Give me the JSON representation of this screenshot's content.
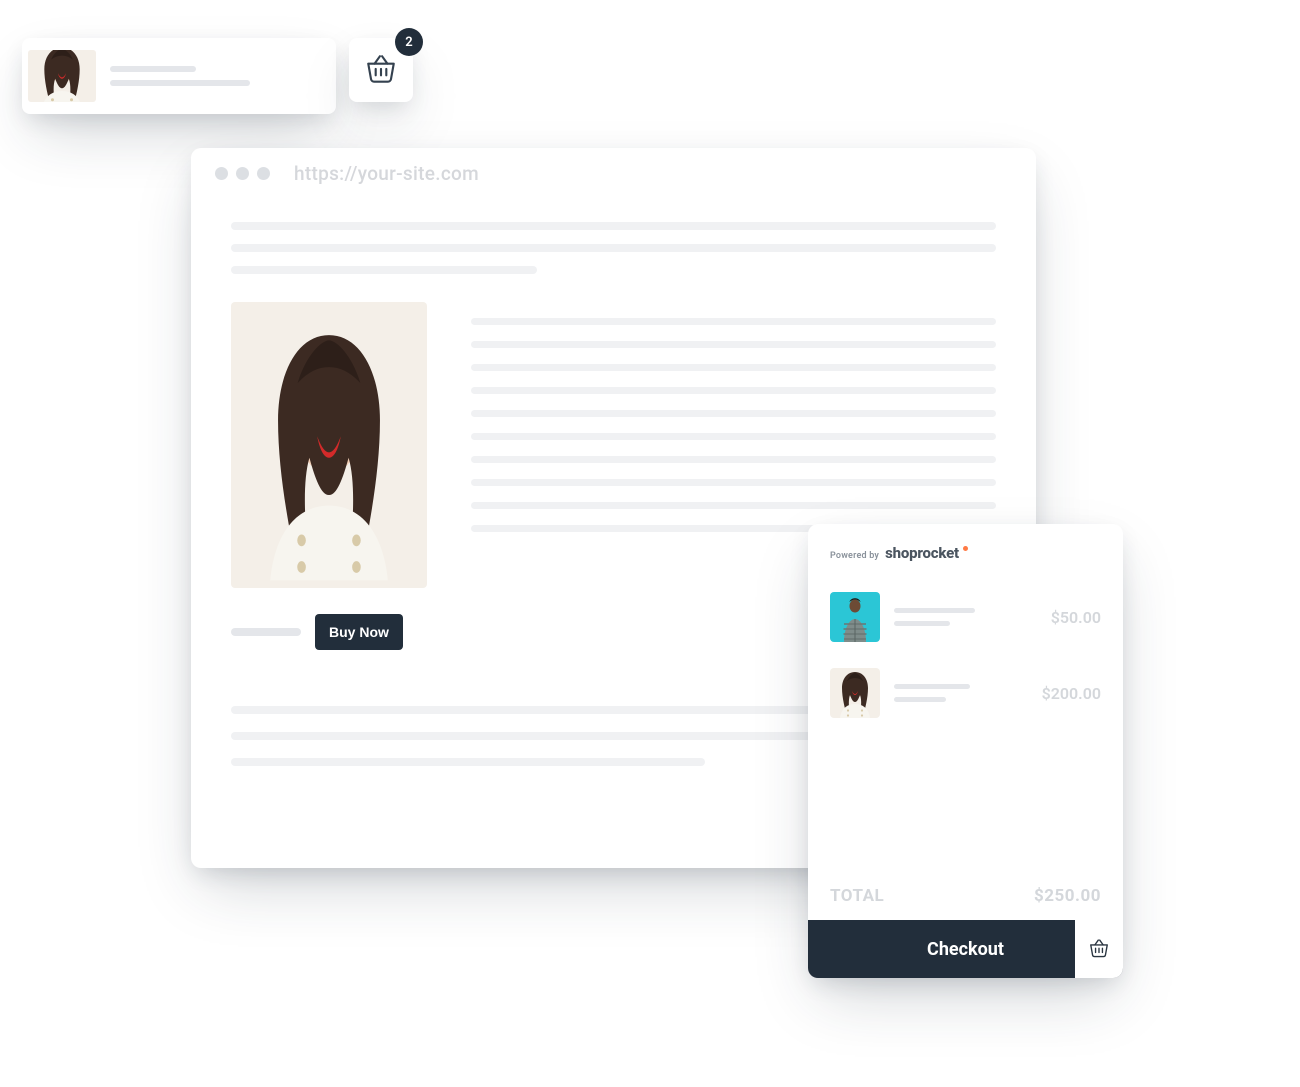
{
  "chip_icon": "basket-icon",
  "basket": {
    "count": "2"
  },
  "browser": {
    "url": "https://your-site.com",
    "buy_label": "Buy Now"
  },
  "cart": {
    "powered_prefix": "Powered by",
    "brand": "shoprocket",
    "items": [
      {
        "thumb": "teal-jacket",
        "price": "$50.00"
      },
      {
        "thumb": "brunette-model",
        "price": "$200.00"
      }
    ],
    "total_label": "TOTAL",
    "total_value": "$250.00",
    "checkout_label": "Checkout"
  }
}
